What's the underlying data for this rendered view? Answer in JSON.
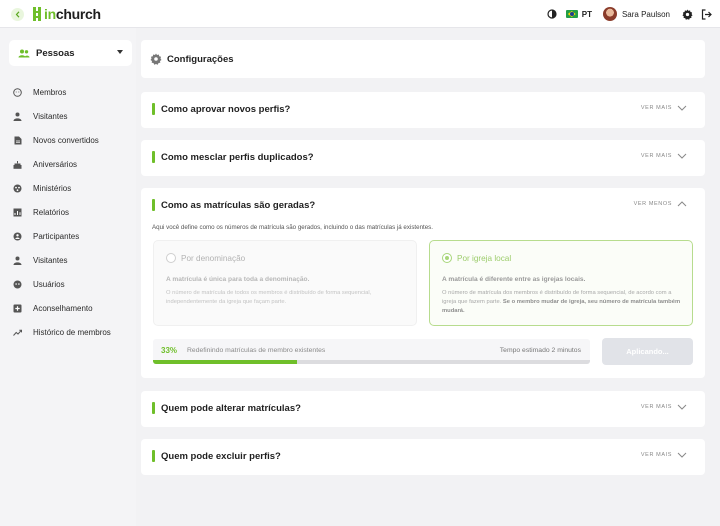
{
  "brand": {
    "name_in": "in",
    "name_rest": "church",
    "accent": "#6fbf2a"
  },
  "topbar": {
    "language": "PT",
    "user_name": "Sara Paulson",
    "icons": [
      "back-icon",
      "theme-toggle-icon",
      "brazil-flag-icon",
      "avatar",
      "settings-icon",
      "logout-icon"
    ]
  },
  "sidebar": {
    "section": "Pessoas",
    "items": [
      {
        "label": "Membros",
        "icon": "face-icon"
      },
      {
        "label": "Visitantes",
        "icon": "person-icon"
      },
      {
        "label": "Novos convertidos",
        "icon": "document-icon"
      },
      {
        "label": "Aniversários",
        "icon": "cake-icon"
      },
      {
        "label": "Ministérios",
        "icon": "group-icon"
      },
      {
        "label": "Relatórios",
        "icon": "report-icon"
      },
      {
        "label": "Participantes",
        "icon": "participants-icon"
      },
      {
        "label": "Visitantes",
        "icon": "person-icon"
      },
      {
        "label": "Usuários",
        "icon": "users-icon"
      },
      {
        "label": "Aconselhamento",
        "icon": "counseling-icon"
      },
      {
        "label": "Histórico de membros",
        "icon": "trend-icon"
      }
    ]
  },
  "main": {
    "title": "Configurações",
    "sections": [
      {
        "title": "Como aprovar novos perfis?",
        "toggle": "VER MAIS"
      },
      {
        "title": "Como mesclar perfis duplicados?",
        "toggle": "VER MAIS"
      },
      {
        "title": "Como as matrículas são geradas?",
        "toggle": "VER MENOS"
      },
      {
        "title": "Quem pode alterar matrículas?",
        "toggle": "VER MAIS"
      },
      {
        "title": "Quem pode excluir perfis?",
        "toggle": "VER MAIS"
      }
    ],
    "expanded": {
      "description": "Aqui você define como os números de matrícula são gerados, incluindo o das matrículas já existentes.",
      "option_a": {
        "label": "Por denominação",
        "subtitle": "A matrícula é única para toda a denominação.",
        "text": "O número de matrícula de todos os membros é distribuído de forma sequencial, independentemente da igreja que façam parte.",
        "selected": false
      },
      "option_b": {
        "label": "Por igreja local",
        "subtitle": "A matrícula é diferente entre as igrejas locais.",
        "text": "O número de matrícula dos membros é distribuído de forma sequencial, de acordo com a igreja que fazem parte.",
        "text_bold": "Se o membro mudar de igreja, seu número de matrícula também mudará.",
        "selected": true
      },
      "progress": {
        "percent_label": "33%",
        "value": 0.33,
        "label": "Redefinindo matrículas de membro existentes",
        "eta": "Tempo estimado 2 minutos"
      },
      "apply_button": "Aplicando..."
    }
  }
}
